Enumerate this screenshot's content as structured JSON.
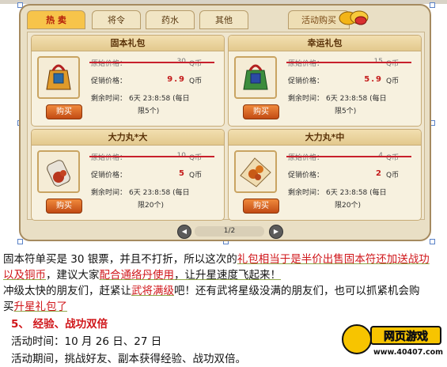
{
  "tabs": [
    {
      "label": "热 卖"
    },
    {
      "label": "将令"
    },
    {
      "label": "药水"
    },
    {
      "label": "其他"
    },
    {
      "label": "活动购买"
    }
  ],
  "cards": [
    {
      "title": "固本礼包",
      "orig_label": "原始价格：",
      "orig_price": "30",
      "orig_cur": "Q币",
      "promo_label": "促销价格：",
      "promo_price": "9.9",
      "promo_cur": "Q币",
      "time_label": "剩余时间：",
      "time_val": "6天 23:8:58 (每日",
      "limit": "限5个)",
      "buy": "购买"
    },
    {
      "title": "幸运礼包",
      "orig_label": "原始价格：",
      "orig_price": "15",
      "orig_cur": "Q币",
      "promo_label": "促销价格：",
      "promo_price": "5.9",
      "promo_cur": "Q币",
      "time_label": "剩余时间：",
      "time_val": "6天 23:8:58 (每日",
      "limit": "限5个)",
      "buy": "购买"
    },
    {
      "title": "大力丸*大",
      "orig_label": "原始价格：",
      "orig_price": "10",
      "orig_cur": "Q币",
      "promo_label": "促销价格：",
      "promo_price": "5",
      "promo_cur": "Q币",
      "time_label": "剩余时间：",
      "time_val": "6天 23:8:58 (每日",
      "limit": "限20个)",
      "buy": "购买"
    },
    {
      "title": "大力丸*中",
      "orig_label": "原始价格：",
      "orig_price": "4",
      "orig_cur": "Q币",
      "promo_label": "促销价格：",
      "promo_price": "2",
      "promo_cur": "Q币",
      "time_label": "剩余时间：",
      "time_val": "6天 23:8:58 (每日",
      "limit": "限20个)",
      "buy": "购买"
    }
  ],
  "pager": {
    "page": "1/2",
    "prev": "◀",
    "next": "▶"
  },
  "article": {
    "p1a": "固本符单买是 30 银票，并且不打折，所以这次的",
    "p1b": "礼包相当于是半价出售固本符还加送战功",
    "p1c": "以及铜币",
    "p1d": "，建议大家",
    "p1e": "配合通络丹使用",
    "p1f": "，让升星速度飞起来！",
    "p2a": "冲级太快的朋友们，赶紧让",
    "p2b": "武将满级",
    "p2c": "吧！还有武将星级没满的朋友们，也可以抓紧机会购",
    "p2d": "买",
    "p2e": "升星礼包了",
    "heading": "5、 经验、战功双倍",
    "time_line": "活动时间：10 月 26 日、27 日",
    "period_line": "活动期间，挑战好友、副本获得经验、战功双倍。"
  },
  "logo": {
    "title": "网页游戏",
    "url": "www.40407.com"
  }
}
